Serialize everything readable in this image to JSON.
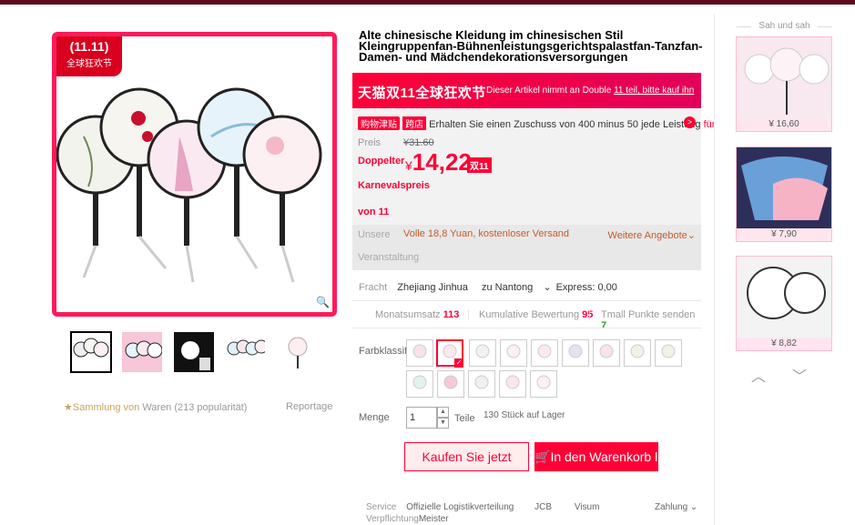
{
  "product": {
    "title": "Alte chinesische Kleidung im chinesischen Stil Kleingruppenfan-Bühnenleistungsgerichtspalastfan-Tanzfan-Damen- und Mädchendekorationsversorgungen",
    "badge_top": "(11.11)",
    "badge_bottom": "全球狂欢节"
  },
  "promo": {
    "main": "天猫双11全球狂欢节",
    "sub_before": "Dieser Artikel nimmt an Double",
    "sub_link": "11 teil, bitte kauf ihn"
  },
  "price": {
    "coupon_tag1": "购物津贴",
    "coupon_tag2": "跨店",
    "coupon_text": "Erhalten Sie einen Zuschuss von 400 minus 50 jede Leistung",
    "coupon_for": "für",
    "preis_label": "Preis",
    "old_price": "¥31.60",
    "doppelter_label": "Doppelter",
    "yen": "¥",
    "new_price": "14,22",
    "dp_tag": "双11",
    "karneval": "Karnevalspreis",
    "von": "von 11",
    "unsere_label": "Unsere",
    "unsere_value": "Volle 18,8 Yuan, kostenloser Versand",
    "weitere": "Weitere Angebote",
    "veranstaltung": "Veranstaltung"
  },
  "shipping": {
    "label": "Fracht",
    "from": "Zhejiang Jinhua",
    "to": "zu Nantong",
    "express": "Express: 0,00"
  },
  "stats": {
    "monats_label": "Monatsumsatz",
    "monats_value": "113",
    "kumul_label": "Kumulative Bewertung",
    "kumul_value": "95",
    "tmall_label": "Tmall Punkte senden",
    "tmall_value": "7"
  },
  "options": {
    "color_label": "Farbklassifizi",
    "swatch_count_text": "13"
  },
  "quantity": {
    "label": "Menge",
    "value": "1",
    "unit": "Teile",
    "stock": "130 Stück auf Lager"
  },
  "actions": {
    "buy_now": "Kaufen Sie jetzt",
    "add_to_cart": "In den Warenkorb legen"
  },
  "service": {
    "label": "Service",
    "items": [
      "Offizielle Logistikverteilung",
      "JCB",
      "Visum"
    ],
    "zahlung": "Zahlung",
    "row2_label": "Verpflichtung",
    "row2_value": "Meister"
  },
  "collect": {
    "label": "Sammlung von",
    "value": "Waren (213 popularität)",
    "report": "Reportage"
  },
  "recommend": {
    "title": "Sah und sah",
    "items": [
      {
        "price": "¥ 16,60"
      },
      {
        "price": "¥ 7,90"
      },
      {
        "price": "¥ 8,82"
      }
    ]
  },
  "colors": {
    "accent": "#ff0036",
    "top_bar": "#5c0c1b"
  }
}
